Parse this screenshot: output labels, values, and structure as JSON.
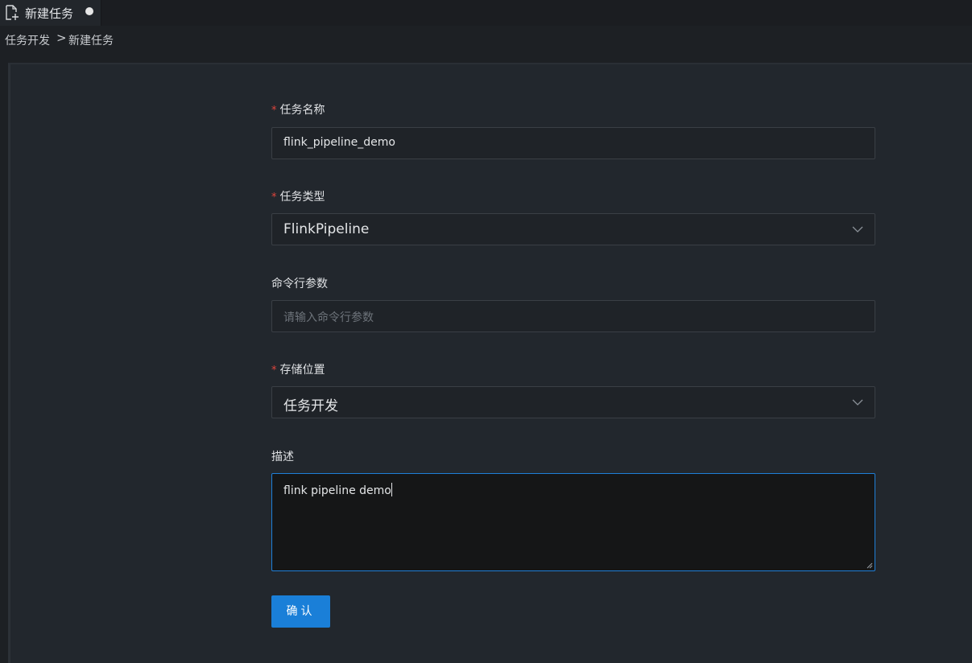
{
  "tab": {
    "title": "新建任务",
    "icon": "new-file-icon",
    "unsaved": true
  },
  "breadcrumb": {
    "items": [
      "任务开发",
      "新建任务"
    ],
    "separator": ">"
  },
  "form": {
    "task_name": {
      "label": "任务名称",
      "required": true,
      "value": "flink_pipeline_demo"
    },
    "task_type": {
      "label": "任务类型",
      "required": true,
      "value": "FlinkPipeline"
    },
    "cli_args": {
      "label": "命令行参数",
      "required": false,
      "placeholder": "请输入命令行参数",
      "value": ""
    },
    "storage": {
      "label": "存储位置",
      "required": true,
      "value": "任务开发"
    },
    "description": {
      "label": "描述",
      "required": false,
      "value": "flink pipeline demo"
    },
    "submit_label": "确认"
  },
  "colors": {
    "accent": "#1a7fd8",
    "required": "#e0453d",
    "background": "#22272d"
  }
}
